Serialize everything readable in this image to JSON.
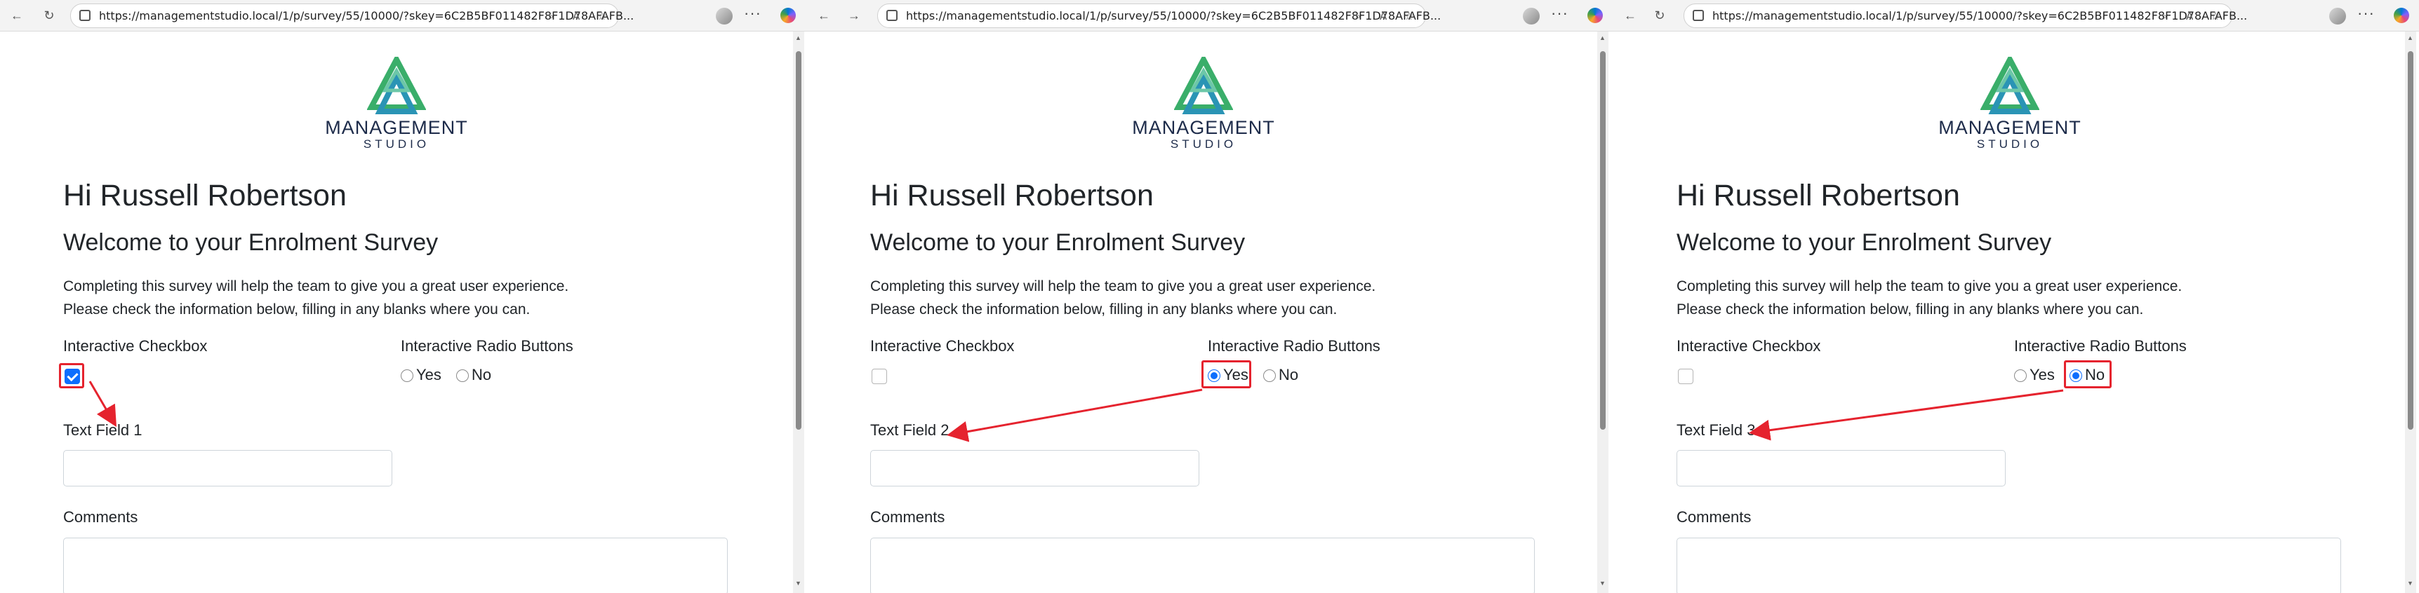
{
  "browser": {
    "url": "https://managementstudio.local/1/p/survey/55/10000/?skey=6C2B5BF011482F8F1D78AFAFB...",
    "nav_icons": [
      "back-icon",
      "forward-icon",
      "refresh-icon",
      "lock-icon",
      "zoom-icon",
      "read-aloud-icon",
      "favorite-icon",
      "more-icon"
    ]
  },
  "logo": {
    "brand": "MANAGEMENT",
    "sub": "STUDIO"
  },
  "page": {
    "greeting": "Hi Russell Robertson",
    "title": "Welcome to your Enrolment Survey",
    "intro_line1": "Completing this survey will help the team to give you a great user experience.",
    "intro_line2": "Please check the information below, filling in any blanks where you can.",
    "checkbox_label": "Interactive Checkbox",
    "radio_label": "Interactive Radio Buttons",
    "radio_yes": "Yes",
    "radio_no": "No",
    "comments_label": "Comments"
  },
  "panels": [
    {
      "text_field_label": "Text Field 1",
      "checkbox_checked": true,
      "radio_selected": "none",
      "highlight": "checkbox"
    },
    {
      "text_field_label": "Text Field 2",
      "checkbox_checked": false,
      "radio_selected": "yes",
      "highlight": "radio-yes"
    },
    {
      "text_field_label": "Text Field 3",
      "checkbox_checked": false,
      "radio_selected": "no",
      "highlight": "radio-no"
    }
  ],
  "colors": {
    "highlight": "#e5232e",
    "checked": "#0d6efd",
    "brand_navy": "#1d2b4a",
    "brand_green": "#3aae6a",
    "brand_teal": "#2a94b5"
  }
}
